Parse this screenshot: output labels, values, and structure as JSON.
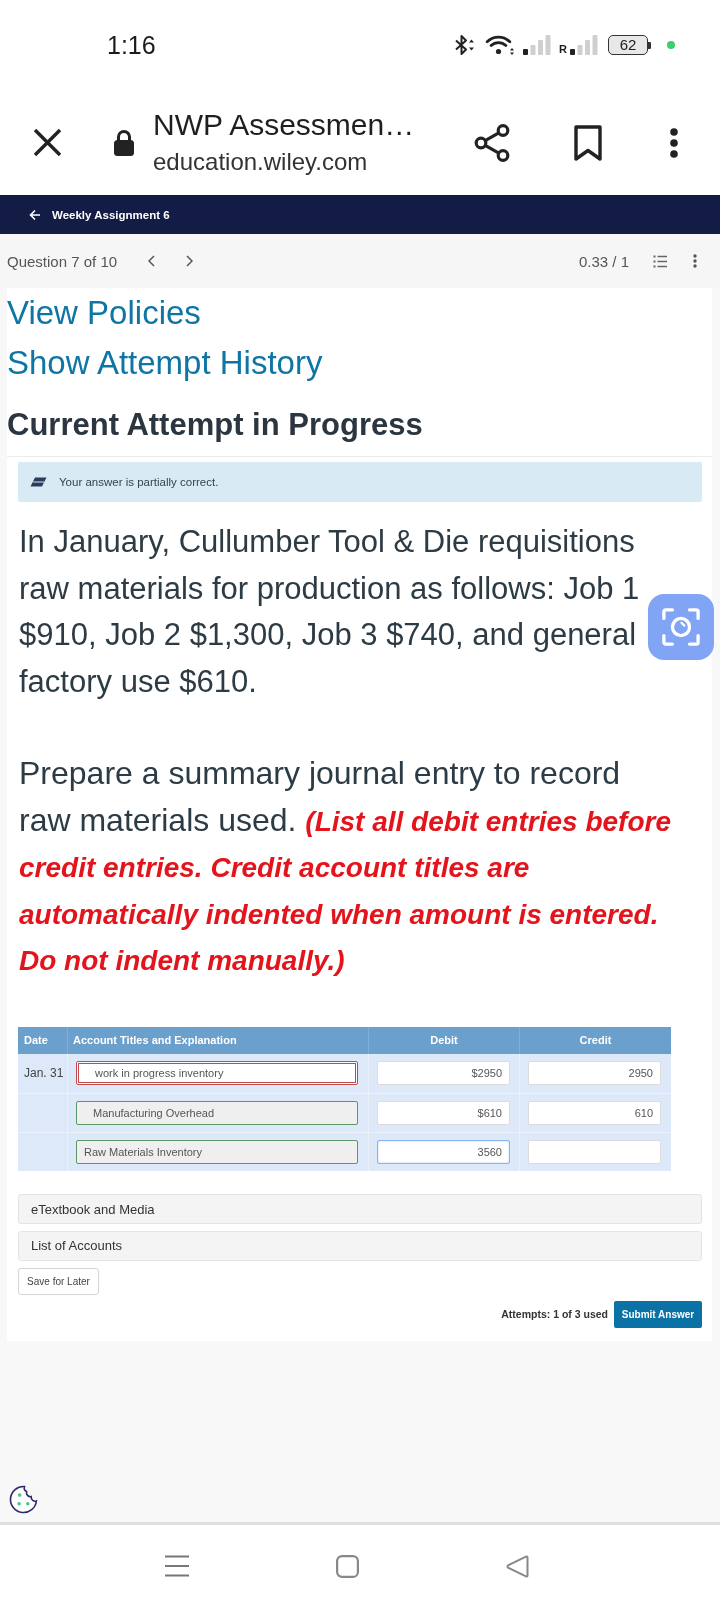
{
  "status_bar": {
    "time": "1:16",
    "network_label": "R",
    "battery": "62"
  },
  "browser": {
    "title": "NWP Assessmen…",
    "url": "education.wiley.com"
  },
  "assignment": {
    "title": "Weekly Assignment 6"
  },
  "question_nav": {
    "position": "Question 7 of 10",
    "score": "0.33 / 1"
  },
  "links": [
    "View Policies",
    "Show Attempt History"
  ],
  "heading": "Current Attempt in Progress",
  "feedback": {
    "message": "Your answer is partially correct."
  },
  "question": {
    "text": "In January, Cullumber Tool & Die requisitions raw materials for production as follows: Job 1 $910, Job 2 $1,300, Job 3 $740, and general factory use $610.",
    "instruction": "Prepare a summary journal entry to record raw materials used. **(List all debit entries before credit entries. Credit account titles are automatically indented when amount is entered. Do not indent manually.)**"
  },
  "journal": {
    "columns": [
      "Date",
      "Account Titles and Explanation",
      "Debit",
      "Credit"
    ],
    "rows": [
      {
        "date": "Jan. 31",
        "account": {
          "value": "work in progress inventory",
          "correct": false,
          "indented": true
        },
        "debit": {
          "value": "$2950",
          "focused": false
        },
        "credit": {
          "value": "2950",
          "focused": false
        }
      },
      {
        "account": {
          "value": "Manufacturing Overhead",
          "correct": true,
          "indented": true
        },
        "debit": {
          "value": "$610",
          "focused": false
        },
        "credit": {
          "value": "610",
          "focused": false
        }
      },
      {
        "account": {
          "value": "Raw Materials Inventory",
          "correct": true,
          "indented": false
        },
        "debit": {
          "value": "3560",
          "focused": true
        },
        "credit": {
          "focused": false
        }
      }
    ]
  },
  "resources": [
    "eTextbook and Media",
    "List of Accounts"
  ],
  "actions": {
    "save": "Save for Later",
    "attempts": "Attempts: 1 of 3 used",
    "submit": "Submit Answer"
  }
}
